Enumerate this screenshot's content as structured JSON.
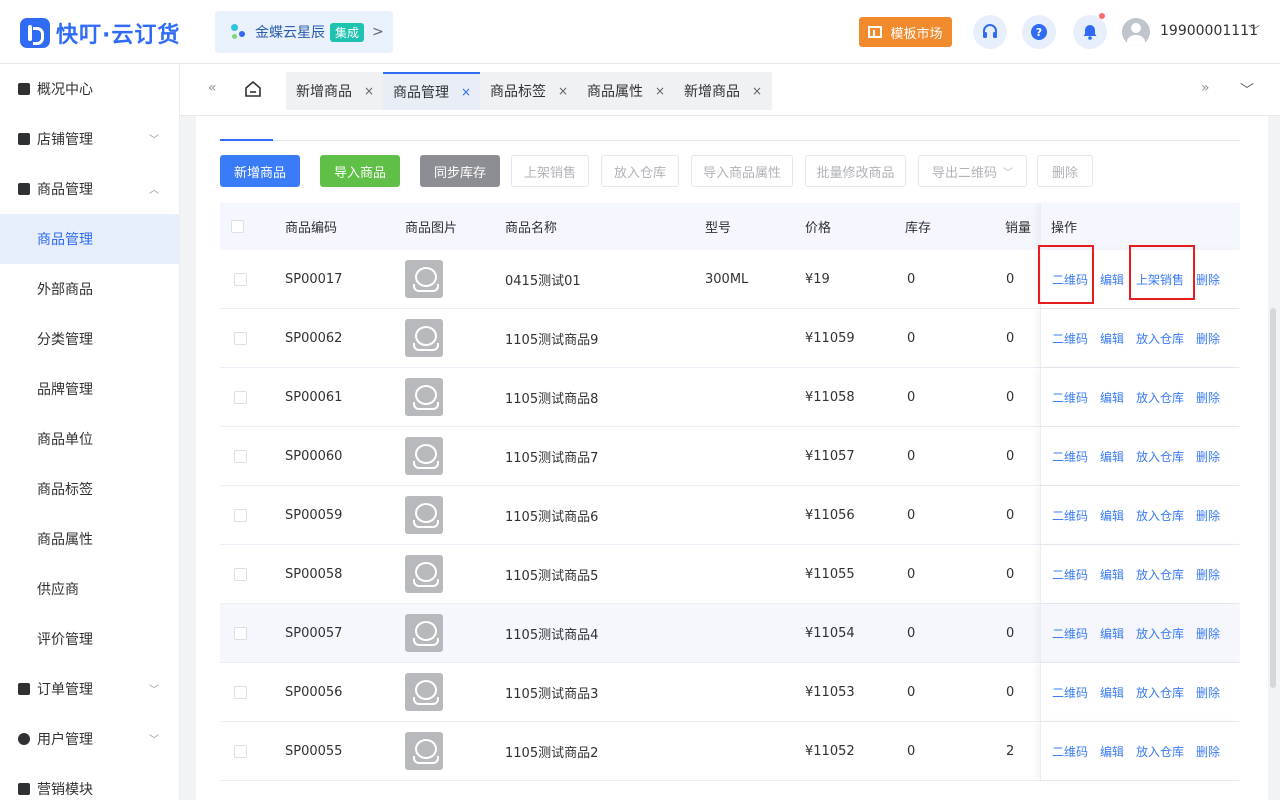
{
  "header": {
    "logo_text": "快叮·云订货",
    "kingdee_name": "金蝶云星辰",
    "kingdee_tag": "集成",
    "kingdee_arrow": ">",
    "template_market": "模板市场",
    "user_phone": "19900001111",
    "colors": {
      "brand": "#2f6bf5",
      "template_btn": "#f28a2e",
      "notify_dot": "#f56c6c"
    }
  },
  "sidebar": {
    "items": [
      {
        "label": "概况中心",
        "icon": "lock-icon",
        "caret": ""
      },
      {
        "label": "店铺管理",
        "icon": "monitor-icon",
        "caret": "chevron-down"
      },
      {
        "label": "商品管理",
        "icon": "box-icon",
        "caret": "chevron-up"
      }
    ],
    "sub_items": [
      "商品管理",
      "外部商品",
      "分类管理",
      "品牌管理",
      "商品单位",
      "商品标签",
      "商品属性",
      "供应商",
      "评价管理"
    ],
    "bottom_items": [
      {
        "label": "订单管理",
        "icon": "clipboard-icon"
      },
      {
        "label": "用户管理",
        "icon": "user-icon"
      },
      {
        "label": "营销模块",
        "icon": "chart-icon"
      }
    ],
    "active_sub": "商品管理"
  },
  "tabs": {
    "items": [
      {
        "label": "新增商品",
        "close": "×"
      },
      {
        "label": "商品管理",
        "close": "×"
      },
      {
        "label": "商品标签",
        "close": "×"
      },
      {
        "label": "商品属性",
        "close": "×"
      },
      {
        "label": "新增商品",
        "close": "×"
      }
    ],
    "active_index": 1
  },
  "toolbar": {
    "add": "新增商品",
    "import": "导入商品",
    "sync_stock": "同步库存",
    "put_on_sale": "上架销售",
    "to_warehouse": "放入仓库",
    "import_attr": "导入商品属性",
    "batch_edit": "批量修改商品",
    "export_qr": "导出二维码",
    "export_qr_caret": "﹀",
    "delete": "删除"
  },
  "table": {
    "headers": {
      "code": "商品编码",
      "image": "商品图片",
      "name": "商品名称",
      "model": "型号",
      "price": "价格",
      "stock": "库存",
      "sales": "销量",
      "ops": "操作"
    },
    "rows": [
      {
        "code": "SP00017",
        "name": "0415测试01",
        "model": "300ML",
        "price": "¥19",
        "stock": "0",
        "sales": "0",
        "ops": [
          "二维码",
          "编辑",
          "上架销售",
          "删除"
        ]
      },
      {
        "code": "SP00062",
        "name": "1105测试商品9",
        "model": "",
        "price": "¥11059",
        "stock": "0",
        "sales": "0",
        "ops": [
          "二维码",
          "编辑",
          "放入仓库",
          "删除"
        ]
      },
      {
        "code": "SP00061",
        "name": "1105测试商品8",
        "model": "",
        "price": "¥11058",
        "stock": "0",
        "sales": "0",
        "ops": [
          "二维码",
          "编辑",
          "放入仓库",
          "删除"
        ]
      },
      {
        "code": "SP00060",
        "name": "1105测试商品7",
        "model": "",
        "price": "¥11057",
        "stock": "0",
        "sales": "0",
        "ops": [
          "二维码",
          "编辑",
          "放入仓库",
          "删除"
        ]
      },
      {
        "code": "SP00059",
        "name": "1105测试商品6",
        "model": "",
        "price": "¥11056",
        "stock": "0",
        "sales": "0",
        "ops": [
          "二维码",
          "编辑",
          "放入仓库",
          "删除"
        ]
      },
      {
        "code": "SP00058",
        "name": "1105测试商品5",
        "model": "",
        "price": "¥11055",
        "stock": "0",
        "sales": "0",
        "ops": [
          "二维码",
          "编辑",
          "放入仓库",
          "删除"
        ]
      },
      {
        "code": "SP00057",
        "name": "1105测试商品4",
        "model": "",
        "price": "¥11054",
        "stock": "0",
        "sales": "0",
        "ops": [
          "二维码",
          "编辑",
          "放入仓库",
          "删除"
        ]
      },
      {
        "code": "SP00056",
        "name": "1105测试商品3",
        "model": "",
        "price": "¥11053",
        "stock": "0",
        "sales": "0",
        "ops": [
          "二维码",
          "编辑",
          "放入仓库",
          "删除"
        ]
      },
      {
        "code": "SP00055",
        "name": "1105测试商品2",
        "model": "",
        "price": "¥11052",
        "stock": "0",
        "sales": "2",
        "ops": [
          "二维码",
          "编辑",
          "放入仓库",
          "删除"
        ]
      }
    ],
    "op_color": "#3a7bf7",
    "highlight_color": "#e51d1d"
  }
}
